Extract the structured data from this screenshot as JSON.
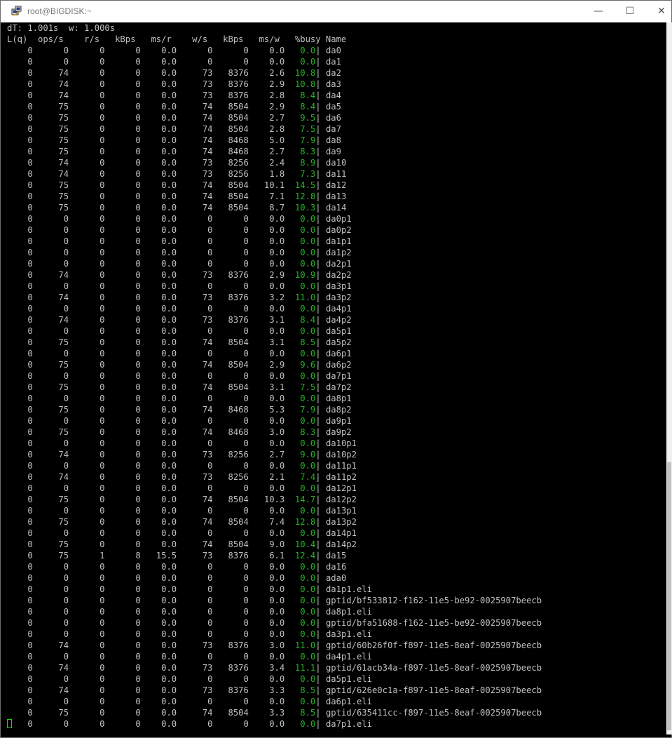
{
  "window": {
    "title": "root@BIGDISK:~",
    "minimize": "—",
    "maximize": "☐",
    "close": "✕"
  },
  "colors": {
    "busy": "#23b523",
    "text": "#c0c0c0",
    "cursor": "#00e600"
  },
  "terminal": {
    "header": "dT: 1.001s  w: 1.000s",
    "columns": "L(q)  ops/s    r/s   kBps   ms/r    w/s   kBps   ms/w   %busy Name",
    "rows": [
      [
        "    0      0      0      0    0.0      0      0    0.0",
        "0.0",
        "da0"
      ],
      [
        "    0      0      0      0    0.0      0      0    0.0",
        "0.0",
        "da1"
      ],
      [
        "    0     74      0      0    0.0     73   8376    2.6",
        "10.8",
        "da2"
      ],
      [
        "    0     74      0      0    0.0     73   8376    2.9",
        "10.8",
        "da3"
      ],
      [
        "    0     74      0      0    0.0     73   8376    2.8",
        "8.4",
        "da4"
      ],
      [
        "    0     75      0      0    0.0     74   8504    2.9",
        "8.4",
        "da5"
      ],
      [
        "    0     75      0      0    0.0     74   8504    2.7",
        "9.5",
        "da6"
      ],
      [
        "    0     75      0      0    0.0     74   8504    2.8",
        "7.5",
        "da7"
      ],
      [
        "    0     75      0      0    0.0     74   8468    5.0",
        "7.9",
        "da8"
      ],
      [
        "    0     75      0      0    0.0     74   8468    2.7",
        "8.3",
        "da9"
      ],
      [
        "    0     74      0      0    0.0     73   8256    2.4",
        "8.9",
        "da10"
      ],
      [
        "    0     74      0      0    0.0     73   8256    1.8",
        "7.3",
        "da11"
      ],
      [
        "    0     75      0      0    0.0     74   8504   10.1",
        "14.5",
        "da12"
      ],
      [
        "    0     75      0      0    0.0     74   8504    7.1",
        "12.8",
        "da13"
      ],
      [
        "    0     75      0      0    0.0     74   8504    8.7",
        "10.3",
        "da14"
      ],
      [
        "    0      0      0      0    0.0      0      0    0.0",
        "0.0",
        "da0p1"
      ],
      [
        "    0      0      0      0    0.0      0      0    0.0",
        "0.0",
        "da0p2"
      ],
      [
        "    0      0      0      0    0.0      0      0    0.0",
        "0.0",
        "da1p1"
      ],
      [
        "    0      0      0      0    0.0      0      0    0.0",
        "0.0",
        "da1p2"
      ],
      [
        "    0      0      0      0    0.0      0      0    0.0",
        "0.0",
        "da2p1"
      ],
      [
        "    0     74      0      0    0.0     73   8376    2.9",
        "10.9",
        "da2p2"
      ],
      [
        "    0      0      0      0    0.0      0      0    0.0",
        "0.0",
        "da3p1"
      ],
      [
        "    0     74      0      0    0.0     73   8376    3.2",
        "11.0",
        "da3p2"
      ],
      [
        "    0      0      0      0    0.0      0      0    0.0",
        "0.0",
        "da4p1"
      ],
      [
        "    0     74      0      0    0.0     73   8376    3.1",
        "8.4",
        "da4p2"
      ],
      [
        "    0      0      0      0    0.0      0      0    0.0",
        "0.0",
        "da5p1"
      ],
      [
        "    0     75      0      0    0.0     74   8504    3.1",
        "8.5",
        "da5p2"
      ],
      [
        "    0      0      0      0    0.0      0      0    0.0",
        "0.0",
        "da6p1"
      ],
      [
        "    0     75      0      0    0.0     74   8504    2.9",
        "9.6",
        "da6p2"
      ],
      [
        "    0      0      0      0    0.0      0      0    0.0",
        "0.0",
        "da7p1"
      ],
      [
        "    0     75      0      0    0.0     74   8504    3.1",
        "7.5",
        "da7p2"
      ],
      [
        "    0      0      0      0    0.0      0      0    0.0",
        "0.0",
        "da8p1"
      ],
      [
        "    0     75      0      0    0.0     74   8468    5.3",
        "7.9",
        "da8p2"
      ],
      [
        "    0      0      0      0    0.0      0      0    0.0",
        "0.0",
        "da9p1"
      ],
      [
        "    0     75      0      0    0.0     74   8468    3.0",
        "8.3",
        "da9p2"
      ],
      [
        "    0      0      0      0    0.0      0      0    0.0",
        "0.0",
        "da10p1"
      ],
      [
        "    0     74      0      0    0.0     73   8256    2.7",
        "9.0",
        "da10p2"
      ],
      [
        "    0      0      0      0    0.0      0      0    0.0",
        "0.0",
        "da11p1"
      ],
      [
        "    0     74      0      0    0.0     73   8256    2.1",
        "7.4",
        "da11p2"
      ],
      [
        "    0      0      0      0    0.0      0      0    0.0",
        "0.0",
        "da12p1"
      ],
      [
        "    0     75      0      0    0.0     74   8504   10.3",
        "14.7",
        "da12p2"
      ],
      [
        "    0      0      0      0    0.0      0      0    0.0",
        "0.0",
        "da13p1"
      ],
      [
        "    0     75      0      0    0.0     74   8504    7.4",
        "12.8",
        "da13p2"
      ],
      [
        "    0      0      0      0    0.0      0      0    0.0",
        "0.0",
        "da14p1"
      ],
      [
        "    0     75      0      0    0.0     74   8504    9.0",
        "10.4",
        "da14p2"
      ],
      [
        "    0     75      1      8   15.5     73   8376    6.1",
        "12.4",
        "da15"
      ],
      [
        "    0      0      0      0    0.0      0      0    0.0",
        "0.0",
        "da16"
      ],
      [
        "    0      0      0      0    0.0      0      0    0.0",
        "0.0",
        "ada0"
      ],
      [
        "    0      0      0      0    0.0      0      0    0.0",
        "0.0",
        "da1p1.eli"
      ],
      [
        "    0      0      0      0    0.0      0      0    0.0",
        "0.0",
        "gptid/bf533812-f162-11e5-be92-0025907beecb"
      ],
      [
        "    0      0      0      0    0.0      0      0    0.0",
        "0.0",
        "da8p1.eli"
      ],
      [
        "    0      0      0      0    0.0      0      0    0.0",
        "0.0",
        "gptid/bfa51688-f162-11e5-be92-0025907beecb"
      ],
      [
        "    0      0      0      0    0.0      0      0    0.0",
        "0.0",
        "da3p1.eli"
      ],
      [
        "    0     74      0      0    0.0     73   8376    3.0",
        "11.0",
        "gptid/60b26f0f-f897-11e5-8eaf-0025907beecb"
      ],
      [
        "    0      0      0      0    0.0      0      0    0.0",
        "0.0",
        "da4p1.eli"
      ],
      [
        "    0     74      0      0    0.0     73   8376    3.4",
        "11.1",
        "gptid/61acb34a-f897-11e5-8eaf-0025907beecb"
      ],
      [
        "    0      0      0      0    0.0      0      0    0.0",
        "0.0",
        "da5p1.eli"
      ],
      [
        "    0     74      0      0    0.0     73   8376    3.3",
        "8.5",
        "gptid/626e0c1a-f897-11e5-8eaf-0025907beecb"
      ],
      [
        "    0      0      0      0    0.0      0      0    0.0",
        "0.0",
        "da6p1.eli"
      ],
      [
        "    0     75      0      0    0.0     74   8504    3.3",
        "8.5",
        "gptid/635411cc-f897-11e5-8eaf-0025907beecb"
      ],
      [
        "    0      0      0      0    0.0      0      0    0.0",
        "0.0",
        "da7p1.eli"
      ]
    ]
  }
}
